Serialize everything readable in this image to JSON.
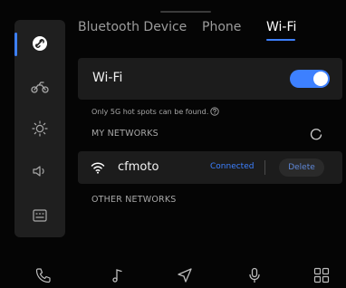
{
  "tabs": [
    {
      "label": "Bluetooth Device",
      "active": false
    },
    {
      "label": "Phone",
      "active": false
    },
    {
      "label": "Wi-Fi",
      "active": true
    }
  ],
  "sidebar": {
    "items": [
      {
        "icon": "link-icon",
        "active": true
      },
      {
        "icon": "motorcycle-icon",
        "active": false
      },
      {
        "icon": "brightness-icon",
        "active": false
      },
      {
        "icon": "volume-icon",
        "active": false
      },
      {
        "icon": "keyboard-icon",
        "active": false
      }
    ]
  },
  "wifi": {
    "label": "Wi-Fi",
    "enabled": true,
    "hint": "Only 5G hot spots can be found."
  },
  "my_networks": {
    "title": "MY NETWORKS",
    "items": [
      {
        "name": "cfmoto",
        "status": "Connected",
        "action": "Delete"
      }
    ]
  },
  "other_networks": {
    "title": "OTHER NETWORKS"
  },
  "bottom_bar": {
    "items": [
      "phone-icon",
      "music-icon",
      "navigation-icon",
      "microphone-icon",
      "apps-grid-icon"
    ]
  },
  "colors": {
    "accent": "#3d80ff",
    "background": "#050505",
    "card": "#1c1c1c"
  }
}
